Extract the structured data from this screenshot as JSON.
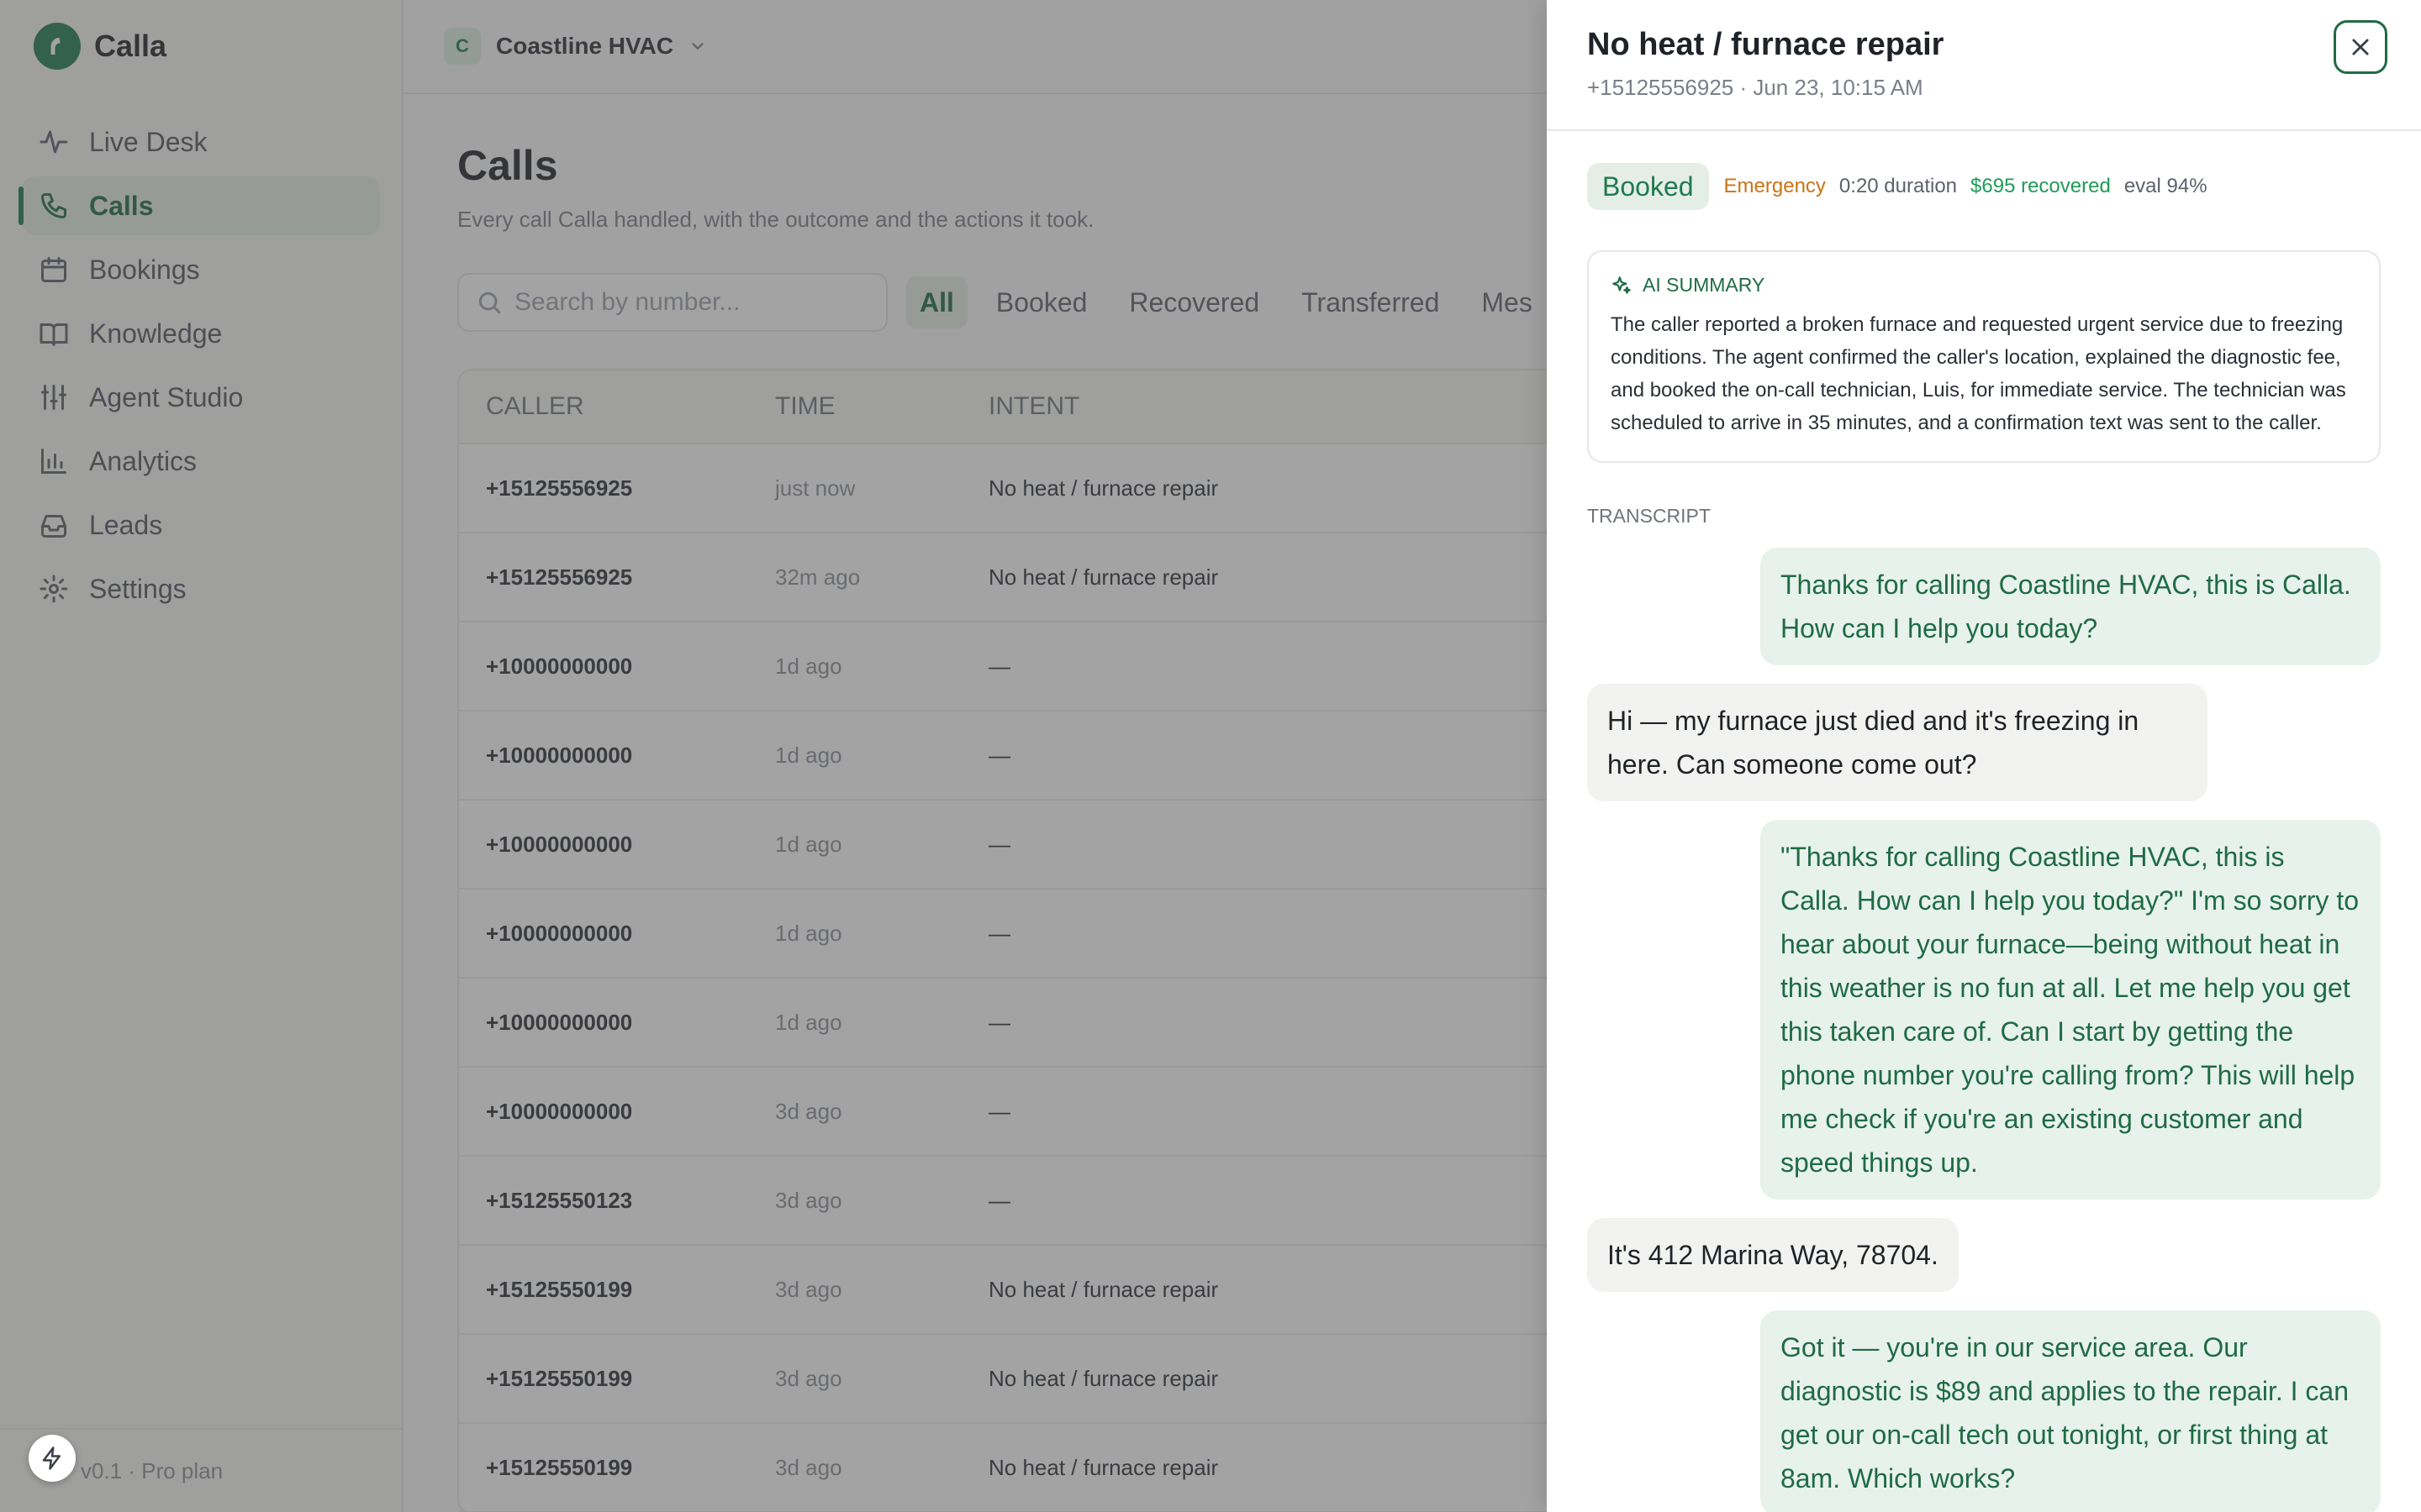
{
  "app": {
    "brand": "Calla",
    "org_badge": "C",
    "org_name": "Coastline HVAC",
    "plan": "v0.1 · Pro plan"
  },
  "sidebar": {
    "items": [
      {
        "label": "Live Desk",
        "icon": "activity-icon",
        "active": false
      },
      {
        "label": "Calls",
        "icon": "phone-icon",
        "active": true
      },
      {
        "label": "Bookings",
        "icon": "calendar-icon",
        "active": false
      },
      {
        "label": "Knowledge",
        "icon": "book-icon",
        "active": false
      },
      {
        "label": "Agent Studio",
        "icon": "sliders-icon",
        "active": false
      },
      {
        "label": "Analytics",
        "icon": "bar-chart-icon",
        "active": false
      },
      {
        "label": "Leads",
        "icon": "inbox-icon",
        "active": false
      },
      {
        "label": "Settings",
        "icon": "gear-icon",
        "active": false
      }
    ]
  },
  "calls": {
    "title": "Calls",
    "subtitle": "Every call Calla handled, with the outcome and the actions it took.",
    "search_placeholder": "Search by number...",
    "filters": [
      "All",
      "Booked",
      "Recovered",
      "Transferred",
      "Mes"
    ],
    "columns": [
      "CALLER",
      "TIME",
      "INTENT"
    ],
    "rows": [
      {
        "caller": "+15125556925",
        "time": "just now",
        "intent": "No heat / furnace repair"
      },
      {
        "caller": "+15125556925",
        "time": "32m ago",
        "intent": "No heat / furnace repair"
      },
      {
        "caller": "+10000000000",
        "time": "1d ago",
        "intent": "—"
      },
      {
        "caller": "+10000000000",
        "time": "1d ago",
        "intent": "—"
      },
      {
        "caller": "+10000000000",
        "time": "1d ago",
        "intent": "—"
      },
      {
        "caller": "+10000000000",
        "time": "1d ago",
        "intent": "—"
      },
      {
        "caller": "+10000000000",
        "time": "1d ago",
        "intent": "—"
      },
      {
        "caller": "+10000000000",
        "time": "3d ago",
        "intent": "—"
      },
      {
        "caller": "+15125550123",
        "time": "3d ago",
        "intent": "—"
      },
      {
        "caller": "+15125550199",
        "time": "3d ago",
        "intent": "No heat / furnace repair"
      },
      {
        "caller": "+15125550199",
        "time": "3d ago",
        "intent": "No heat / furnace repair"
      },
      {
        "caller": "+15125550199",
        "time": "3d ago",
        "intent": "No heat / furnace repair"
      }
    ]
  },
  "drawer": {
    "title": "No heat / furnace repair",
    "subtitle": "+15125556925 · Jun 23, 10:15 AM",
    "status": "Booked",
    "priority": "Emergency",
    "duration": "0:20 duration",
    "recovered": "$695 recovered",
    "eval": "eval 94%",
    "summary_label": "AI SUMMARY",
    "summary": "The caller reported a broken furnace and requested urgent service due to freezing conditions. The agent confirmed the caller's location, explained the diagnostic fee, and booked the on-call technician, Luis, for immediate service. The technician was scheduled to arrive in 35 minutes, and a confirmation text was sent to the caller.",
    "transcript_label": "TRANSCRIPT",
    "messages": [
      {
        "role": "agent",
        "text": "Thanks for calling Coastline HVAC, this is Calla. How can I help you today?"
      },
      {
        "role": "caller",
        "text": "Hi — my furnace just died and it's freezing in here. Can someone come out?"
      },
      {
        "role": "agent",
        "text": "\"Thanks for calling Coastline HVAC, this is Calla. How can I help you today?\" I'm so sorry to hear about your furnace—being without heat in this weather is no fun at all. Let me help you get this taken care of. Can I start by getting the phone number you're calling from? This will help me check if you're an existing customer and speed things up."
      },
      {
        "role": "caller",
        "text": "It's 412 Marina Way, 78704."
      },
      {
        "role": "agent",
        "text": "Got it — you're in our service area. Our diagnostic is $89 and applies to the repair. I can get our on-call tech out tonight, or first thing at 8am. Which works?"
      }
    ]
  },
  "colors": {
    "accent": "#1f7a4f",
    "accent_soft": "#e4eee7",
    "emergency": "#c97414",
    "recovered": "#1f9a5a"
  }
}
